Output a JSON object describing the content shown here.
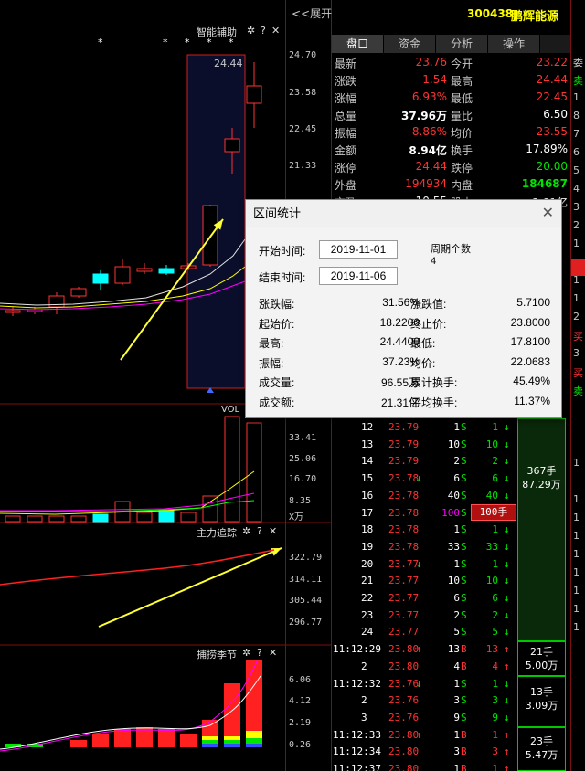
{
  "header": {
    "expand_label": "<<展开",
    "stock_code": "300438",
    "stock_name": "鹏辉能源"
  },
  "tabs": [
    "盘口",
    "资金",
    "分析",
    "操作"
  ],
  "quote": [
    {
      "l1": "最新",
      "v1": "23.76",
      "l2": "今开",
      "v2": "23.22"
    },
    {
      "l1": "涨跌",
      "v1": "1.54",
      "l2": "最高",
      "v2": "24.44"
    },
    {
      "l1": "涨幅",
      "v1": "6.93%",
      "l2": "最低",
      "v2": "22.45"
    },
    {
      "l1": "总量",
      "v1": "37.96万",
      "l2": "量比",
      "v2": "6.50"
    },
    {
      "l1": "振幅",
      "v1": "8.86%",
      "l2": "均价",
      "v2": "23.55"
    },
    {
      "l1": "金额",
      "v1": "8.94亿",
      "l2": "换手",
      "v2": "17.89%"
    },
    {
      "l1": "涨停",
      "v1": "24.44",
      "l2": "跌停",
      "v2": "20.00"
    },
    {
      "l1": "外盘",
      "v1": "194934",
      "l2": "内盘",
      "v2": "184687"
    },
    {
      "l1": "市盈",
      "v1": "10.55",
      "l2": "股本",
      "v2": "2.81亿"
    }
  ],
  "ticks": [
    {
      "t": "12",
      "p": "23.79",
      "v": "1",
      "bs": "S",
      "n": "1",
      "arrow": "down"
    },
    {
      "t": "13",
      "p": "23.79",
      "v": "10",
      "bs": "S",
      "n": "10",
      "arrow": "down"
    },
    {
      "t": "14",
      "p": "23.79",
      "v": "2",
      "bs": "S",
      "n": "2",
      "arrow": "down"
    },
    {
      "t": "15",
      "p": "23.78",
      "v": "6",
      "bs": "S",
      "n": "6",
      "arrow": "down",
      "parrow": "down"
    },
    {
      "t": "16",
      "p": "23.78",
      "v": "40",
      "bs": "S",
      "n": "40",
      "arrow": "down"
    },
    {
      "t": "17",
      "p": "23.78",
      "v": "100",
      "bs": "S",
      "n": "100手",
      "arrow": "",
      "hl": true
    },
    {
      "t": "18",
      "p": "23.78",
      "v": "1",
      "bs": "S",
      "n": "1",
      "arrow": "down"
    },
    {
      "t": "19",
      "p": "23.78",
      "v": "33",
      "bs": "S",
      "n": "33",
      "arrow": "down"
    },
    {
      "t": "20",
      "p": "23.77",
      "v": "1",
      "bs": "S",
      "n": "1",
      "arrow": "down",
      "parrow": "down"
    },
    {
      "t": "21",
      "p": "23.77",
      "v": "10",
      "bs": "S",
      "n": "10",
      "arrow": "down"
    },
    {
      "t": "22",
      "p": "23.77",
      "v": "6",
      "bs": "S",
      "n": "6",
      "arrow": "down"
    },
    {
      "t": "23",
      "p": "23.77",
      "v": "2",
      "bs": "S",
      "n": "2",
      "arrow": "down"
    },
    {
      "t": "24",
      "p": "23.77",
      "v": "5",
      "bs": "S",
      "n": "5",
      "arrow": "down"
    },
    {
      "t": "11:12:29",
      "p": "23.80",
      "v": "13",
      "bs": "B",
      "n": "13",
      "arrow": "up",
      "parrow": "up"
    },
    {
      "t": "2",
      "p": "23.80",
      "v": "4",
      "bs": "B",
      "n": "4",
      "arrow": "up"
    },
    {
      "t": "11:12:32",
      "p": "23.76",
      "v": "1",
      "bs": "S",
      "n": "1",
      "arrow": "down",
      "parrow": "down"
    },
    {
      "t": "2",
      "p": "23.76",
      "v": "3",
      "bs": "S",
      "n": "3",
      "arrow": "down"
    },
    {
      "t": "3",
      "p": "23.76",
      "v": "9",
      "bs": "S",
      "n": "9",
      "arrow": "down"
    },
    {
      "t": "11:12:33",
      "p": "23.80",
      "v": "1",
      "bs": "B",
      "n": "1",
      "arrow": "up",
      "parrow": "up"
    },
    {
      "t": "11:12:34",
      "p": "23.80",
      "v": "3",
      "bs": "B",
      "n": "3",
      "arrow": "up"
    },
    {
      "t": "11:12:37",
      "p": "23.80",
      "v": "1",
      "bs": "B",
      "n": "1",
      "arrow": "up"
    }
  ],
  "groups": [
    {
      "a": "367手",
      "b": "87.29万"
    },
    {
      "a": "21手",
      "b": "5.00万"
    },
    {
      "a": "13手",
      "b": "3.09万"
    },
    {
      "a": "23手",
      "b": "5.47万"
    }
  ],
  "far_col": [
    "委",
    "卖",
    "1",
    "8",
    "7",
    "6",
    "5",
    "4",
    "3",
    "2",
    "1",
    "1",
    "1",
    "2",
    "买",
    "3",
    "买",
    "卖",
    "1",
    "1",
    "1",
    "1",
    "1",
    "1",
    "1",
    "1",
    "1"
  ],
  "panes": {
    "main_title": "智能辅助",
    "vol_title": "VOL",
    "zl_title": "主力追踪",
    "bc_title": "捕捞季节",
    "high_label": "24.44",
    "vol_unit": "X万"
  },
  "axis": {
    "main": [
      "24.70",
      "23.58",
      "22.45",
      "21.33"
    ],
    "vol": [
      "33.41",
      "25.06",
      "16.70",
      "8.35"
    ],
    "zl": [
      "322.79",
      "314.11",
      "305.44",
      "296.77"
    ],
    "bc": [
      "6.06",
      "4.12",
      "2.19",
      "0.26"
    ]
  },
  "stars": [
    "*",
    "*",
    "*",
    "*",
    "*"
  ],
  "icons": {
    "gear": "✲",
    "help": "?",
    "close": "✕"
  },
  "dialog": {
    "title": "区间统计",
    "start_label": "开始时间:",
    "start_value": "2019-11-01",
    "end_label": "结束时间:",
    "end_value": "2019-11-06",
    "period_label": "周期个数",
    "period_value": "4",
    "stats": [
      {
        "l1": "涨跌幅:",
        "v1": "31.56%",
        "l2": "涨跌值:",
        "v2": "5.7100"
      },
      {
        "l1": "起始价:",
        "v1": "18.2200",
        "l2": "终止价:",
        "v2": "23.8000"
      },
      {
        "l1": "最高:",
        "v1": "24.4400",
        "l2": "最低:",
        "v2": "17.8100"
      },
      {
        "l1": "振幅:",
        "v1": "37.23%",
        "l2": "均价:",
        "v2": "22.0683"
      },
      {
        "l1": "成交量:",
        "v1": "96.55万",
        "l2": "累计换手:",
        "v2": "45.49%"
      },
      {
        "l1": "成交额:",
        "v1": "21.31亿",
        "l2": "平均换手:",
        "v2": "11.37%"
      }
    ]
  }
}
